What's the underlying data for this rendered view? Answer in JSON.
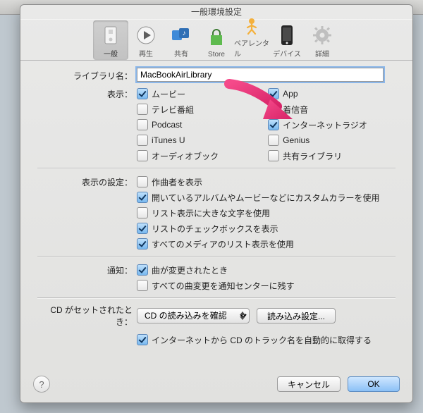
{
  "title": "一般環境設定",
  "toolbar": [
    {
      "id": "general",
      "label": "一般",
      "selected": true
    },
    {
      "id": "playback",
      "label": "再生",
      "selected": false
    },
    {
      "id": "sharing",
      "label": "共有",
      "selected": false
    },
    {
      "id": "store",
      "label": "Store",
      "selected": false
    },
    {
      "id": "parental",
      "label": "ペアレンタル",
      "selected": false
    },
    {
      "id": "devices",
      "label": "デバイス",
      "selected": false
    },
    {
      "id": "advanced",
      "label": "詳細",
      "selected": false
    }
  ],
  "library": {
    "label": "ライブラリ名：",
    "value": "MacBookAirLibrary"
  },
  "show": {
    "label": "表示：",
    "left": [
      {
        "label": "ムービー",
        "checked": true
      },
      {
        "label": "テレビ番組",
        "checked": false
      },
      {
        "label": "Podcast",
        "checked": false
      },
      {
        "label": "iTunes U",
        "checked": false
      },
      {
        "label": "オーディオブック",
        "checked": false
      }
    ],
    "right": [
      {
        "label": "App",
        "checked": true
      },
      {
        "label": "着信音",
        "checked": false
      },
      {
        "label": "インターネットラジオ",
        "checked": true
      },
      {
        "label": "Genius",
        "checked": false
      },
      {
        "label": "共有ライブラリ",
        "checked": false
      }
    ]
  },
  "view": {
    "label": "表示の設定：",
    "items": [
      {
        "label": "作曲者を表示",
        "checked": false
      },
      {
        "label": "開いているアルバムやムービーなどにカスタムカラーを使用",
        "checked": true
      },
      {
        "label": "リスト表示に大きな文字を使用",
        "checked": false
      },
      {
        "label": "リストのチェックボックスを表示",
        "checked": true
      },
      {
        "label": "すべてのメディアのリスト表示を使用",
        "checked": true
      }
    ]
  },
  "notify": {
    "label": "通知：",
    "items": [
      {
        "label": "曲が変更されたとき",
        "checked": true
      },
      {
        "label": "すべての曲変更を通知センターに残す",
        "checked": false
      }
    ]
  },
  "cd": {
    "label": "CD がセットされたとき：",
    "dropdown": {
      "selected": "CD の読み込みを確認"
    },
    "import_button": "読み込み設定...",
    "auto_names": "インターネットから CD のトラック名を自動的に取得する"
  },
  "footer": {
    "cancel": "キャンセル",
    "ok": "OK"
  },
  "annotation": {
    "arrow_target": "checkbox-internet-radio",
    "color": "#e8317a"
  }
}
